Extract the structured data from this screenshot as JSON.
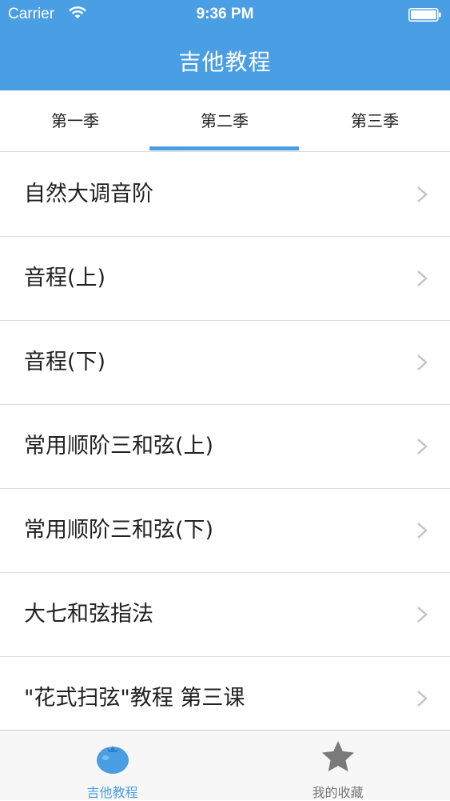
{
  "status_bar": {
    "carrier": "Carrier",
    "time": "9:36 PM"
  },
  "nav": {
    "title": "吉他教程"
  },
  "tabs": [
    {
      "label": "第一季",
      "selected": false
    },
    {
      "label": "第二季",
      "selected": true
    },
    {
      "label": "第三季",
      "selected": false
    }
  ],
  "lessons": [
    {
      "title": "自然大调音阶"
    },
    {
      "title": "音程(上)"
    },
    {
      "title": "音程(下)"
    },
    {
      "title": "常用顺阶三和弦(上)"
    },
    {
      "title": "常用顺阶三和弦(下)"
    },
    {
      "title": "大七和弦指法"
    },
    {
      "title": "\"花式扫弦\"教程 第三课"
    }
  ],
  "tab_bar": {
    "items": [
      {
        "label": "吉他教程",
        "icon": "tomato-icon",
        "active": true
      },
      {
        "label": "我的收藏",
        "icon": "star-icon",
        "active": false
      }
    ]
  },
  "colors": {
    "accent": "#4a9ee3",
    "inactive": "#777777"
  }
}
